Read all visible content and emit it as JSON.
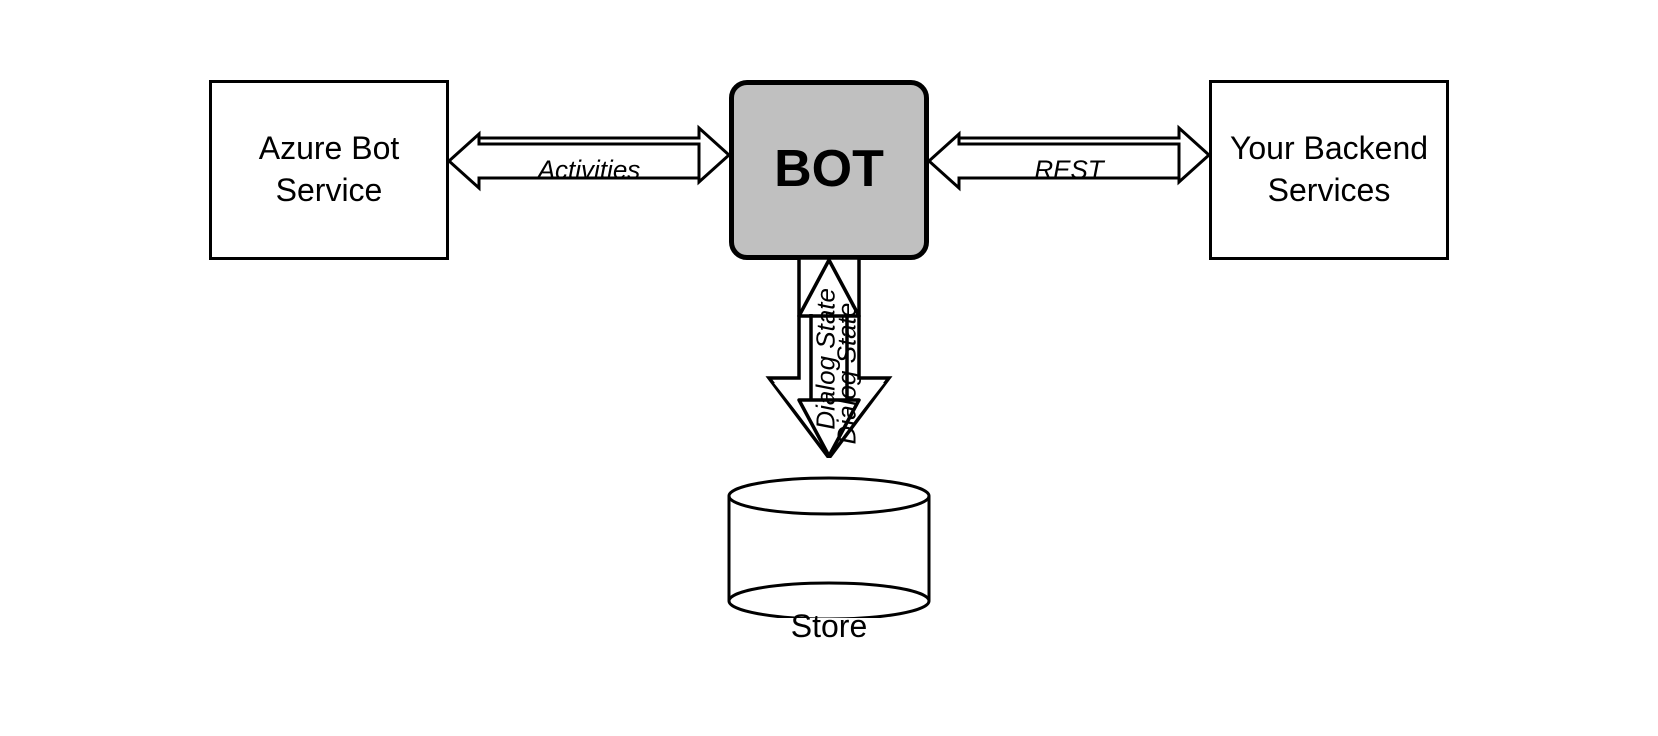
{
  "diagram": {
    "azure_box_label": "Azure Bot\nService",
    "bot_box_label": "BOT",
    "backend_box_label": "Your Backend\nServices",
    "activities_label": "Activities",
    "rest_label": "REST",
    "dialog_state_label": "Dialog State",
    "store_label": "Store",
    "colors": {
      "background": "#ffffff",
      "box_border": "#000000",
      "bot_fill": "#c0c0c0",
      "arrow_fill": "#ffffff",
      "arrow_stroke": "#000000"
    }
  }
}
